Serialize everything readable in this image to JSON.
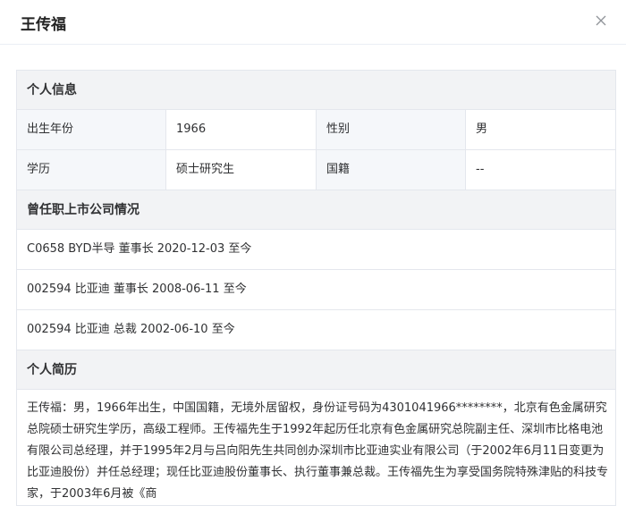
{
  "modal": {
    "title": "王传福"
  },
  "personal_info": {
    "heading": "个人信息",
    "rows": [
      {
        "label1": "出生年份",
        "value1": "1966",
        "label2": "性别",
        "value2": "男"
      },
      {
        "label1": "学历",
        "value1": "硕士研究生",
        "label2": "国籍",
        "value2": "--"
      }
    ]
  },
  "positions": {
    "heading": "曾任职上市公司情况",
    "items": [
      "C0658 BYD半导 董事长 2020-12-03 至今",
      "002594 比亚迪 董事长 2008-06-11 至今",
      "002594 比亚迪 总裁 2002-06-10 至今"
    ]
  },
  "bio": {
    "heading": "个人简历",
    "text": "王传福：男，1966年出生，中国国籍，无境外居留权，身份证号码为4301041966********，北京有色金属研究总院硕士研究生学历，高级工程师。王传福先生于1992年起历任北京有色金属研究总院副主任、深圳市比格电池有限公司总经理，并于1995年2月与吕向阳先生共同创办深圳市比亚迪实业有限公司（于2002年6月11日变更为比亚迪股份）并任总经理；现任比亚迪股份董事长、执行董事兼总裁。王传福先生为享受国务院特殊津贴的科技专家，于2003年6月被《商"
  }
}
